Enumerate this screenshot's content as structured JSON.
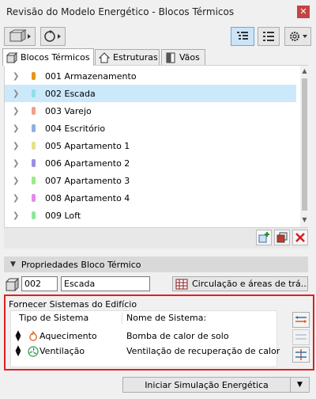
{
  "window": {
    "title": "Revisão do Modelo Energético - Blocos Térmicos",
    "close_glyph": "✕"
  },
  "toolbar": {
    "left_icons": [
      "model-3d-icon",
      "refresh-icon"
    ],
    "right_icons": [
      "tree-view-icon",
      "list-view-icon",
      "settings-icon"
    ]
  },
  "tabs": [
    {
      "label": "Blocos Térmicos",
      "icon": "thermal-blocks-icon",
      "active": true
    },
    {
      "label": "Estruturas",
      "icon": "house-icon",
      "active": false
    },
    {
      "label": "Vãos",
      "icon": "window-icon",
      "active": false
    }
  ],
  "blocks": [
    {
      "label": "001 Armazenamento",
      "color": "#e8941a",
      "selected": false
    },
    {
      "label": "002 Escada",
      "color": "#8ee0e8",
      "selected": true
    },
    {
      "label": "003 Varejo",
      "color": "#f0a08c",
      "selected": false
    },
    {
      "label": "004 Escritório",
      "color": "#8cb0e0",
      "selected": false
    },
    {
      "label": "005 Apartamento 1",
      "color": "#e8e08c",
      "selected": false
    },
    {
      "label": "006 Apartamento 2",
      "color": "#a08ce0",
      "selected": false
    },
    {
      "label": "007 Apartamento 3",
      "color": "#9ce88c",
      "selected": false
    },
    {
      "label": "008 Apartamento 4",
      "color": "#e08ce8",
      "selected": false
    },
    {
      "label": "009 Loft",
      "color": "#8ce89c",
      "selected": false
    }
  ],
  "properties": {
    "header": "Propriedades Bloco Térmico",
    "code": "002",
    "name": "Escada",
    "circulation_button": "Circulação e áreas de trá..."
  },
  "systems": {
    "title": "Fornecer Sistemas do Edifício",
    "col_type": "Tipo de Sistema",
    "col_name": "Nome de Sistema:",
    "rows": [
      {
        "type": "Aquecimento",
        "name": "Bomba de calor de solo",
        "icon": "flame-icon"
      },
      {
        "type": "Ventilação",
        "name": "Ventilação de recuperação de calor",
        "icon": "fan-icon"
      }
    ]
  },
  "footer": {
    "start_button": "Iniciar Simulação Energética"
  },
  "colors": {
    "selection": "#cce8fb",
    "highlight_border": "#e02020",
    "close_button": "#c74343"
  }
}
